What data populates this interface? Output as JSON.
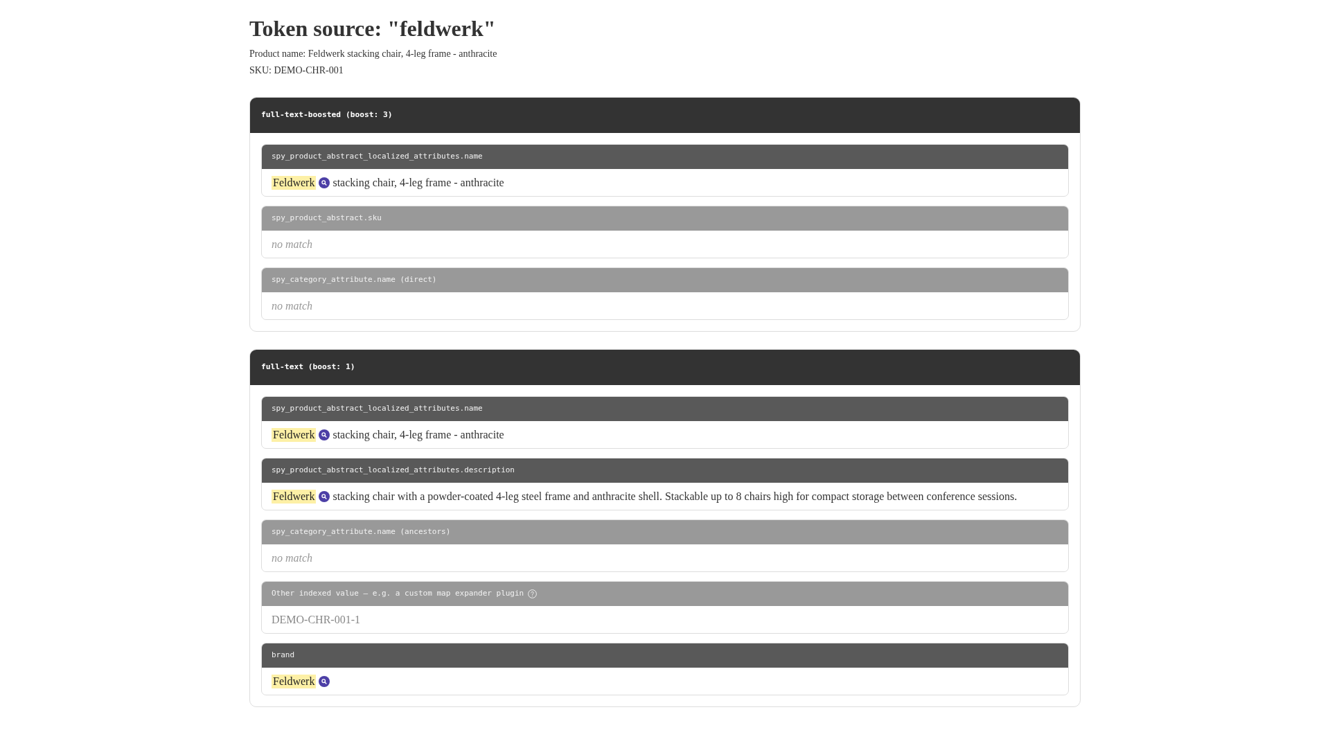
{
  "title": "Token source: \"feldwerk\"",
  "meta": [
    "Product name: Feldwerk stacking chair, 4-leg frame - anthracite",
    "SKU: DEMO-CHR-001"
  ],
  "sources": [
    {
      "title": "full-text-boosted (boost: 3)",
      "fields": [
        {
          "label": "spy_product_abstract_localized_attributes.name",
          "kind": "match",
          "term": "Feldwerk",
          "rest": "stacking chair, 4-leg frame - anthracite"
        },
        {
          "label": "spy_product_abstract.sku",
          "kind": "no_match",
          "value": "no match"
        },
        {
          "label": "spy_category_attribute.name (direct)",
          "kind": "no_match",
          "value": "no match"
        }
      ]
    },
    {
      "title": "full-text (boost: 1)",
      "fields": [
        {
          "label": "spy_product_abstract_localized_attributes.name",
          "kind": "match",
          "term": "Feldwerk",
          "rest": "stacking chair, 4-leg frame - anthracite"
        },
        {
          "label": "spy_product_abstract_localized_attributes.description",
          "kind": "match",
          "term": "Feldwerk",
          "rest": "stacking chair with a powder-coated 4-leg steel frame and anthracite shell. Stackable up to 8 chairs high for compact storage between conference sessions."
        },
        {
          "label": "spy_category_attribute.name (ancestors)",
          "kind": "no_match",
          "value": "no match"
        },
        {
          "label": "Other indexed value — e.g. a custom map expander plugin",
          "kind": "other",
          "value": "DEMO-CHR-001-1"
        },
        {
          "label": "brand",
          "kind": "match",
          "term": "Feldwerk"
        }
      ]
    }
  ]
}
